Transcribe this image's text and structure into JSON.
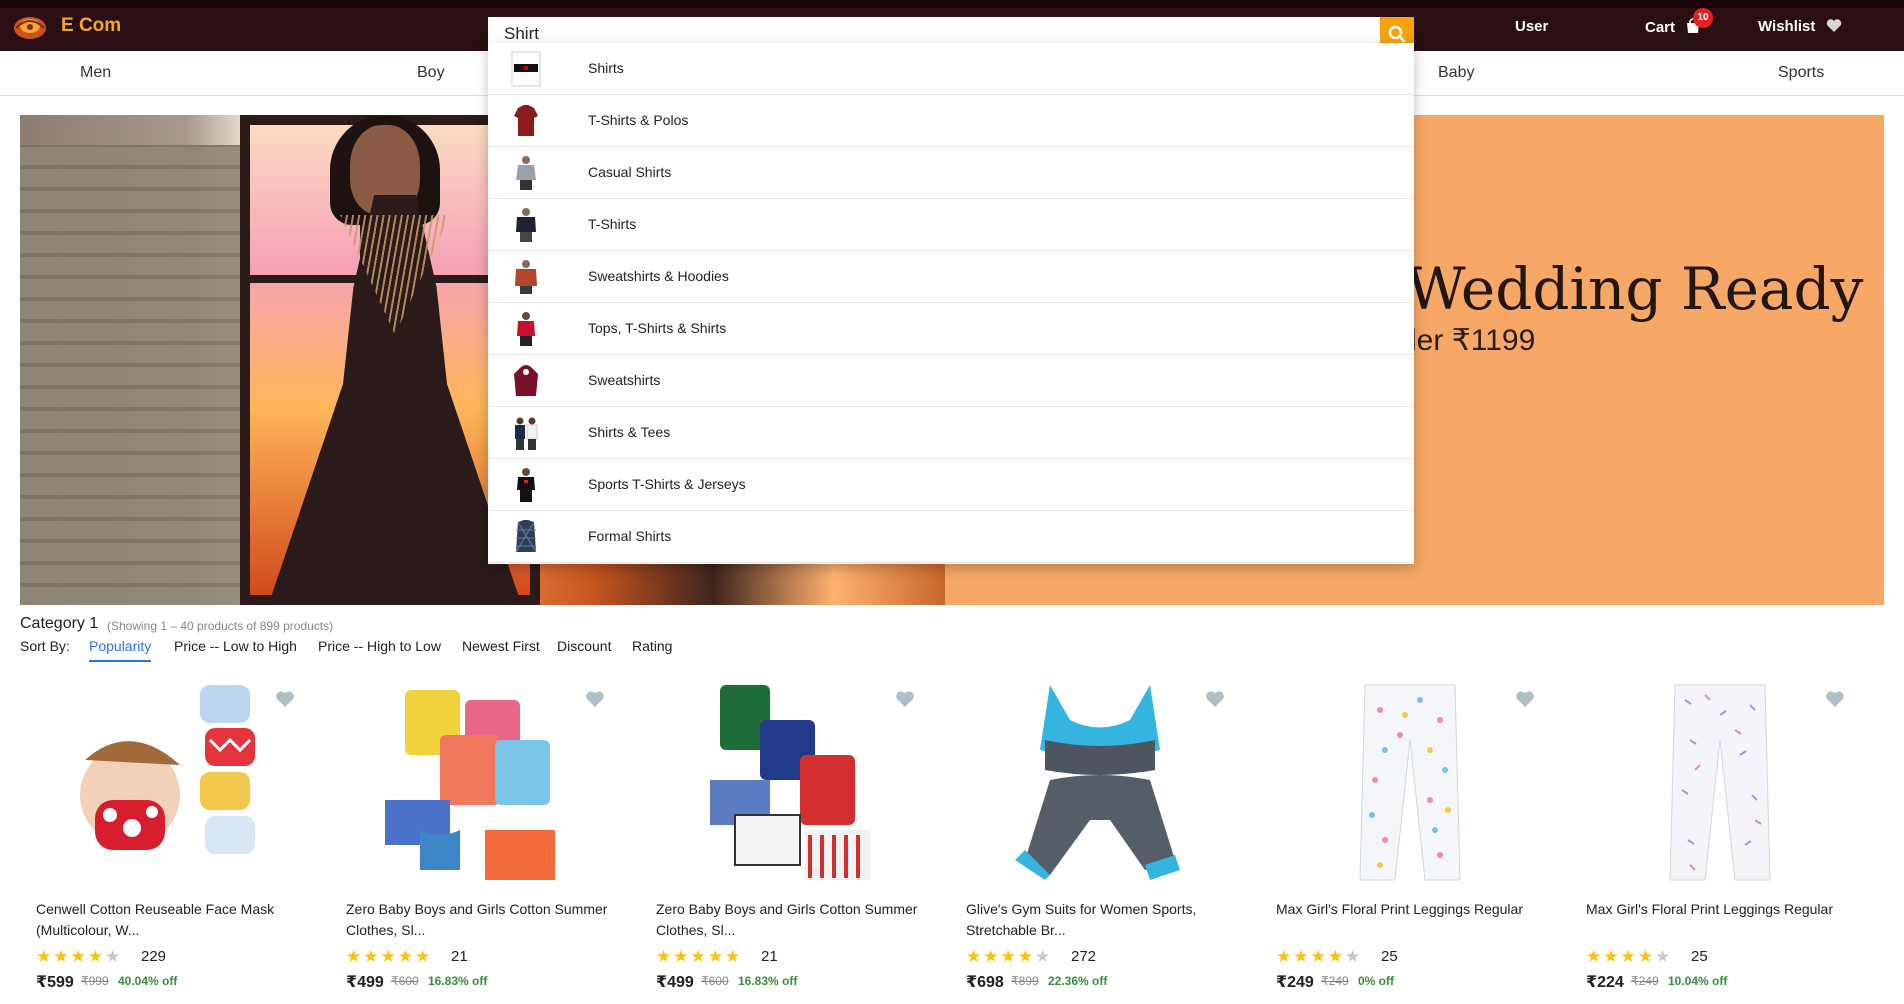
{
  "header": {
    "brand": "E Com",
    "search_value": "Shirt",
    "user_label": "User",
    "cart_label": "Cart",
    "cart_count": "10",
    "wishlist_label": "Wishlist"
  },
  "nav": {
    "items": [
      "Men",
      "Boy",
      "Baby",
      "Sports"
    ]
  },
  "banner": {
    "heading": "Wedding Ready",
    "subheading": "der ₹1199"
  },
  "dropdown": {
    "items": [
      "Shirts",
      "T-Shirts & Polos",
      "Casual Shirts",
      "T-Shirts",
      "Sweatshirts & Hoodies",
      "Tops, T-Shirts & Shirts",
      "Sweatshirts",
      "Shirts & Tees",
      "Sports T-Shirts & Jerseys",
      "Formal Shirts"
    ]
  },
  "listing": {
    "title": "Category 1",
    "count_text": "(Showing 1 – 40 products of 899 products)",
    "sort_label": "Sort By:",
    "sort_options": [
      "Popularity",
      "Price -- Low to High",
      "Price -- High to Low",
      "Newest First",
      "Discount",
      "Rating"
    ],
    "active_sort": "Popularity"
  },
  "products": [
    {
      "title_line1": "Cenwell Cotton Reuseable Face Mask",
      "title_line2": "(Multicolour, W...",
      "rating": 4,
      "rating_count": "229",
      "price": "₹599",
      "mrp": "₹999",
      "discount": "40.04% off"
    },
    {
      "title_line1": "Zero Baby Boys and Girls Cotton Summer",
      "title_line2": "Clothes, Sl...",
      "rating": 5,
      "rating_count": "21",
      "price": "₹499",
      "mrp": "₹600",
      "discount": "16.83% off"
    },
    {
      "title_line1": "Zero Baby Boys and Girls Cotton Summer",
      "title_line2": "Clothes, Sl...",
      "rating": 5,
      "rating_count": "21",
      "price": "₹499",
      "mrp": "₹600",
      "discount": "16.83% off"
    },
    {
      "title_line1": "Glive's Gym Suits for Women Sports,",
      "title_line2": "Stretchable Br...",
      "rating": 4,
      "rating_count": "272",
      "price": "₹698",
      "mrp": "₹899",
      "discount": "22.36% off"
    },
    {
      "title_line1": "Max Girl's Floral Print Leggings Regular",
      "title_line2": "",
      "rating": 4,
      "rating_count": "25",
      "price": "₹249",
      "mrp": "₹249",
      "discount": "0% off"
    },
    {
      "title_line1": "Max Girl's Floral Print Leggings Regular",
      "title_line2": "",
      "rating": 4,
      "rating_count": "25",
      "price": "₹224",
      "mrp": "₹249",
      "discount": "10.04% off"
    }
  ],
  "colors": {
    "header_bg": "#2a0f12",
    "brand": "#f5a623",
    "search_button": "#f5a20f",
    "active_sort": "#2874f0",
    "discount": "#388e3c",
    "banner_bg": "#f7a867"
  },
  "icons": {
    "logo": "brand-logo-icon",
    "search": "search-icon",
    "cart": "shopping-bag-icon",
    "wishlist": "heart-icon"
  }
}
